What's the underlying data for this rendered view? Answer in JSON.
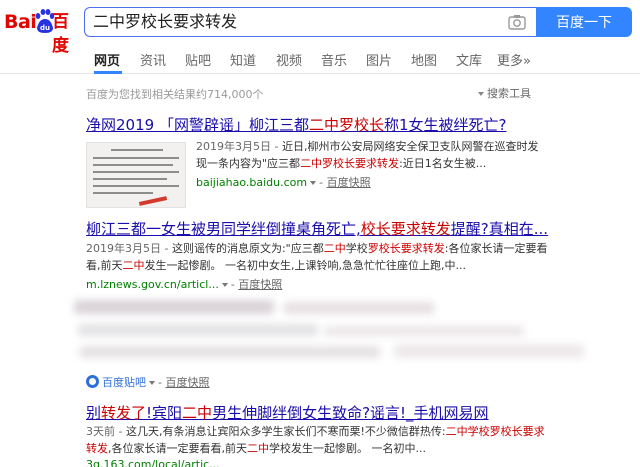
{
  "logo": {
    "latin": "Bai",
    "paw_text": "du",
    "chinese": "百度"
  },
  "search": {
    "query": "二中罗校长要求转发",
    "button_label": "百度一下"
  },
  "nav": {
    "tabs": [
      {
        "label": "网页",
        "active": true
      },
      {
        "label": "资讯"
      },
      {
        "label": "贴吧"
      },
      {
        "label": "知道"
      },
      {
        "label": "视频"
      },
      {
        "label": "音乐"
      },
      {
        "label": "图片"
      },
      {
        "label": "地图"
      },
      {
        "label": "文库"
      },
      {
        "label": "更多»"
      }
    ]
  },
  "stats": "百度为您找到相关结果约714,000个",
  "tools": "搜索工具",
  "results": [
    {
      "title_pre": "净网2019 「网警辟谣」柳江三都",
      "title_hl": "二中罗校长",
      "title_post": "称1女生被绊死亡?",
      "date": "2019年3月5日 -",
      "line1": " 近日,柳州市公安局网络安全保卫支队网警在巡查时发",
      "line2_pre": "现一条内容为\"应三都",
      "line2_hl": "二中罗校长要求转发",
      "line2_post": ":近日1名女生被...",
      "url": "baijiahao.baidu.com",
      "snapshot": "百度快照"
    },
    {
      "title_pre": "柳江三都一女生被男同学绊倒撞桌角死亡,",
      "title_hl": "校长要求转发",
      "title_post": "提醒?真相在...",
      "date": "2019年3月5日 -",
      "line1_pre": " 这则谣传的消息原文为:\"应三都",
      "line1_hl": "二中",
      "line1_mid": "学校",
      "line1_hl2": "罗校长要求转发",
      "line1_post": ":各位家长请一定要看",
      "line2_pre": "看,前天",
      "line2_hl": "二中",
      "line2_post": "发生一起惨剧。 一名初中女生,上课铃响,急急忙忙往座位上跑,中...",
      "url": "m.lznews.gov.cn/articl...",
      "snapshot": "百度快照"
    },
    {
      "source": "百度贴吧",
      "snapshot": "百度快照"
    },
    {
      "title_pre": "别",
      "title_hl": "转发了",
      "title_mid": "!宾阳",
      "title_hl2": "二中",
      "title_post": "男生伸脚绊倒女生致命?谣言!_手机网易网",
      "date": "3天前 -",
      "line1_pre": " 这几天,有条消息让宾阳众多学生家长们不寒而栗!不少微信群热传:",
      "line1_hl": "二中学校罗校长要求",
      "line2_hl": "转发",
      "line2_mid": ",各位家长请一定要看看,前天",
      "line2_hl2": "二中",
      "line2_post": "学校发生一起惨剧。 一名初中...",
      "url": "3g.163.com/local/artic..."
    }
  ],
  "colors": {
    "link": "#1a0dab",
    "highlight": "#cc0000",
    "url": "#008000",
    "button": "#3385ff",
    "logo_red": "#e10602",
    "logo_blue": "#2932e1"
  }
}
